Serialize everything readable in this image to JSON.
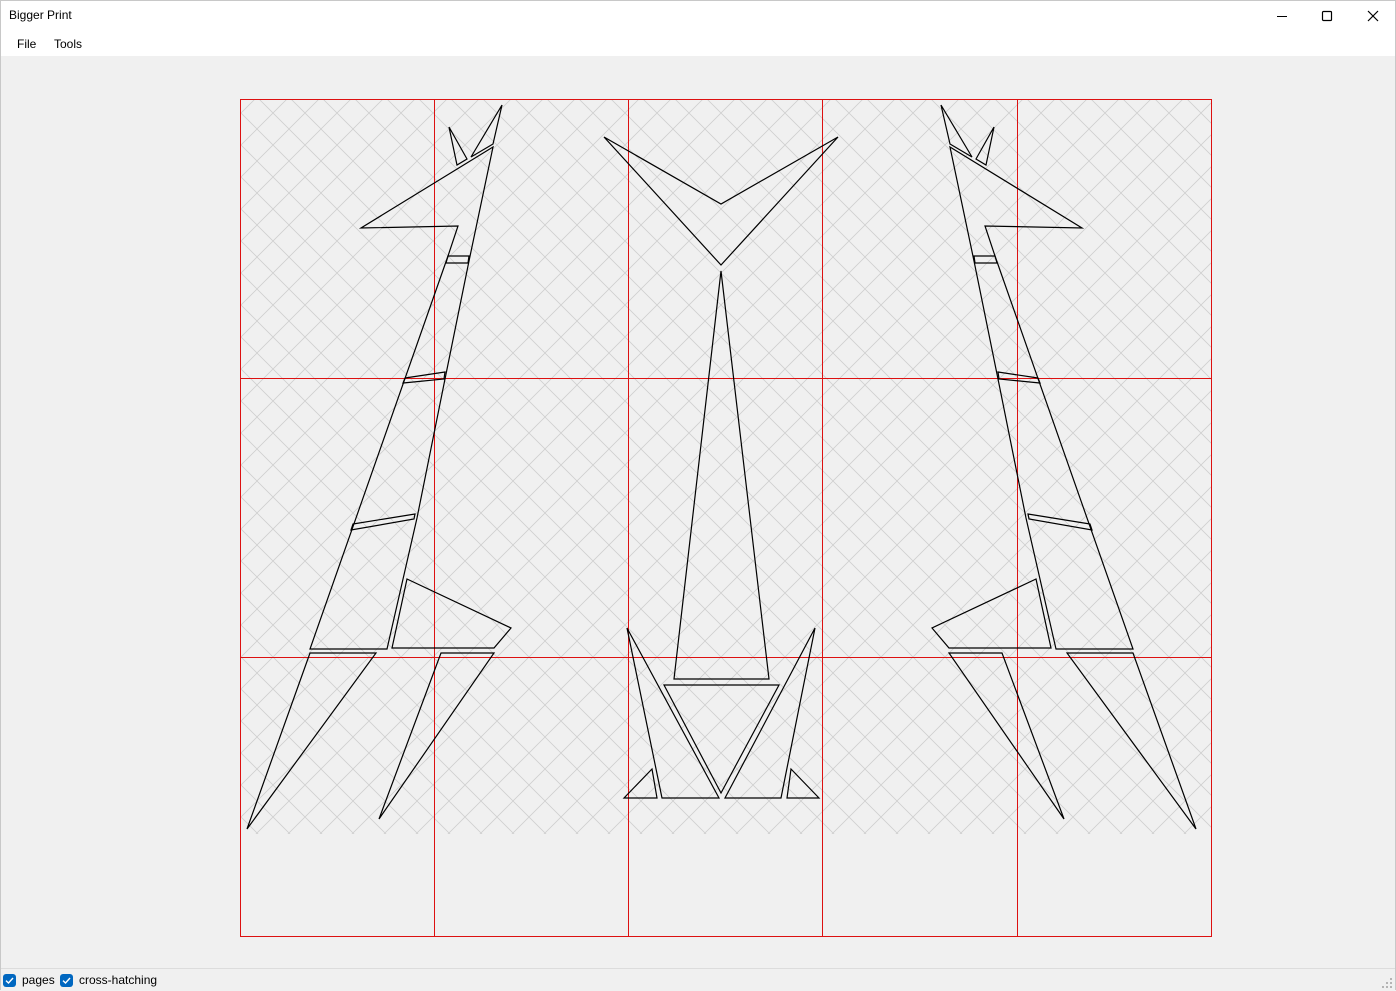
{
  "window": {
    "title": "Bigger Print",
    "controls": {
      "minimize_icon": "minimize-icon",
      "maximize_icon": "maximize-icon",
      "close_icon": "close-icon"
    }
  },
  "menu": {
    "items": [
      {
        "label": "File"
      },
      {
        "label": "Tools"
      }
    ]
  },
  "status": {
    "pages_label": "pages",
    "pages_checked": true,
    "crosshatch_label": "cross-hatching",
    "crosshatch_checked": true
  },
  "document": {
    "page_columns": 5,
    "page_rows": 3,
    "grid_color": "#dd1111",
    "drawing_color": "#000000",
    "hatch_color": "#c8c8c8",
    "accent_color": "#0067c0"
  }
}
